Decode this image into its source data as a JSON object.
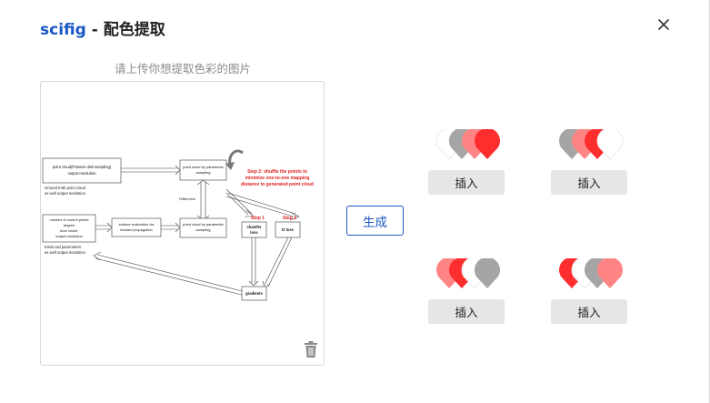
{
  "header": {
    "brand": "scifig",
    "separator": " - ",
    "title": "配色提取"
  },
  "upload": {
    "hint": "请上传你想提取色彩的图片"
  },
  "figure": {
    "box1": "point cloud(Poisson disk sampling)",
    "box1b": "output resolution",
    "gt_note1": "Ground truth point cloud",
    "gt_note2": "as well output resolution",
    "box2": "point cloud by parametric",
    "box2b": "sampling",
    "step2_1": "Step 2: shuffle the points to",
    "step2_2": "minimize one-to-one mapping",
    "step2_3": "distance to generated point cloud",
    "difference": "Difference",
    "box3_1": "number of control points",
    "box3_2": "degree",
    "box3_3": "knot vector",
    "box3_4": "output resolution",
    "init1": "Initial cad parameters",
    "init2": "as well output resolution",
    "box4_1": "surface evaluation via",
    "box4_2": "forward propagation",
    "box5_1": "point cloud by parametric",
    "box5_2": "sampling",
    "step1": "Step 1",
    "step3": "Step 3",
    "chamfer1": "chamfer",
    "chamfer2": "loss",
    "l2": "l2 loss",
    "gradients": "gradients"
  },
  "generate": {
    "label": "生成"
  },
  "palettes": [
    {
      "colors": [
        "#ffffff",
        "#a5a5a5",
        "#ff8585",
        "#ff2e2e"
      ],
      "insert_label": "插入"
    },
    {
      "colors": [
        "#a5a5a5",
        "#ff8585",
        "#ff2e2e",
        "#ffffff"
      ],
      "insert_label": "插入"
    },
    {
      "colors": [
        "#ff8585",
        "#ff2e2e",
        "#ffffff",
        "#a5a5a5"
      ],
      "insert_label": "插入"
    },
    {
      "colors": [
        "#ff2e2e",
        "#ffffff",
        "#a5a5a5",
        "#ff8585"
      ],
      "insert_label": "插入"
    }
  ],
  "icons": {
    "close": "close-icon",
    "trash": "trash-icon"
  }
}
